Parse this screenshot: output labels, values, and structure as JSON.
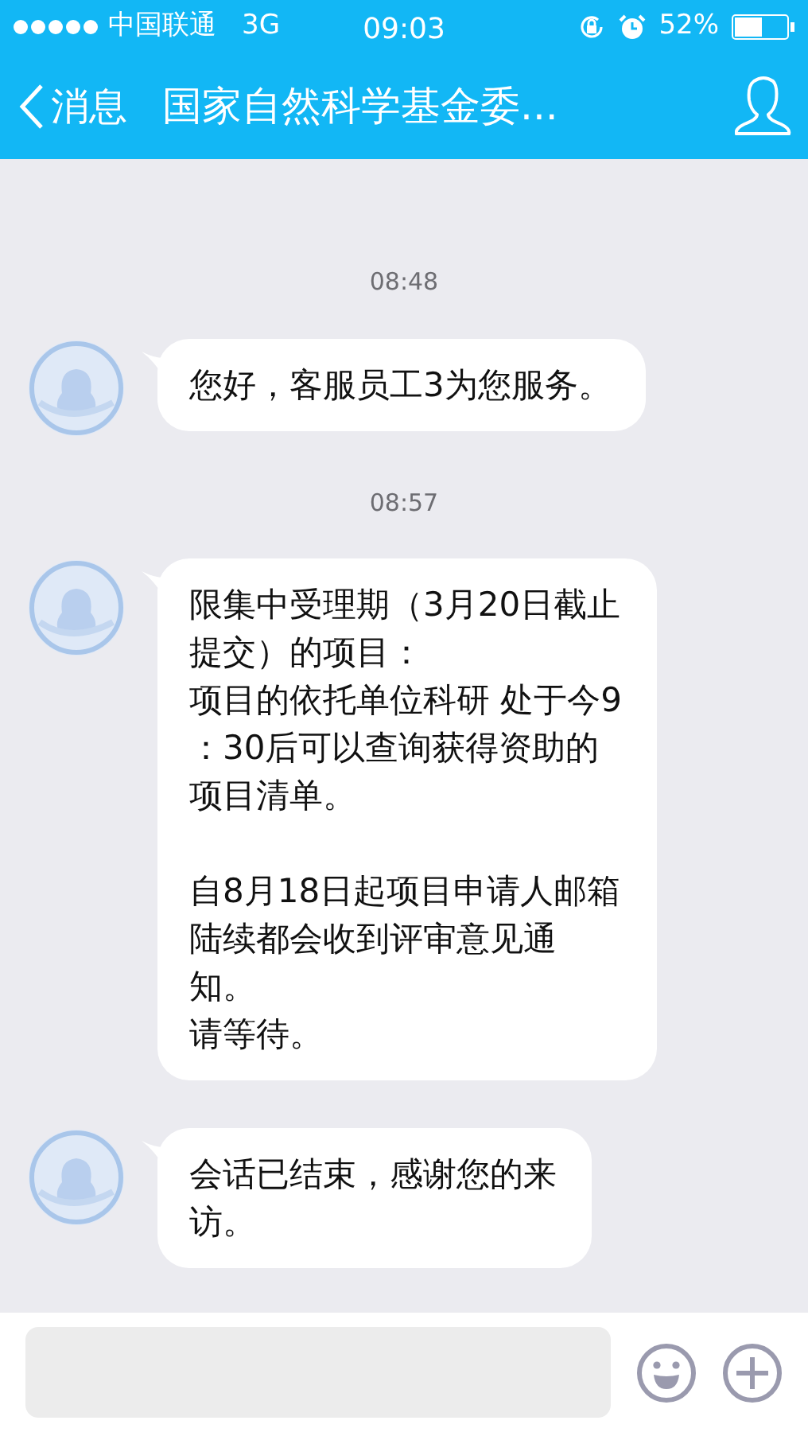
{
  "status_bar": {
    "carrier": "中国联通",
    "network": "3G",
    "time": "09:03",
    "battery": "52%"
  },
  "nav_bar": {
    "back": "消息",
    "title": "国家自然科学基金委..."
  },
  "messages": [
    {
      "timestamp": "08:48",
      "paragraphs": [
        [
          "您好，客服员工3为您服务。"
        ]
      ]
    },
    {
      "timestamp": "08:57",
      "paragraphs": [
        [
          "限集中受理期（3月20日截止",
          "提交）的项目：",
          "项目的依托单位科研 处于今9",
          "：30后可以查询获得资助的",
          "项目清单。"
        ],
        [
          "自8月18日起项目申请人邮箱",
          "陆续都会收到评审意见通",
          "知。",
          "请等待。"
        ]
      ]
    },
    {
      "paragraphs": [
        [
          "会话已结束，感谢您的来",
          "访。"
        ]
      ]
    }
  ]
}
